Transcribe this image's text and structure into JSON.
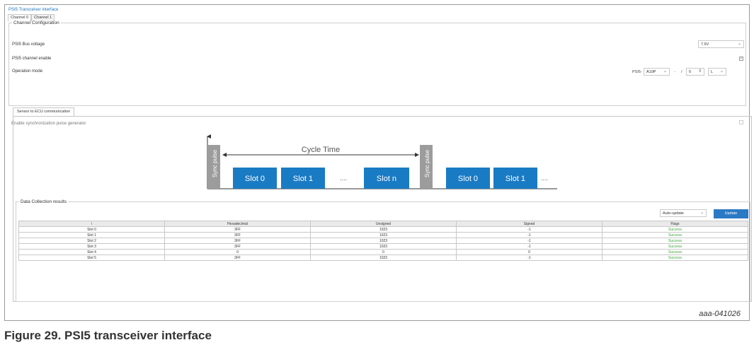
{
  "app": {
    "title": "PSI5 Transceiver interface"
  },
  "tabs": [
    "Channel 0",
    "Channel 1"
  ],
  "channel_configuration": {
    "legend": "Channel Configuration",
    "bus_voltage": {
      "label": "PSI5 Bus voltage",
      "value": "7.6V"
    },
    "channel_enable": {
      "label": "PSI5 channel enable",
      "checked": true
    },
    "operation_mode": {
      "label": "Operation mode",
      "prefix": "PSI5-",
      "mode": "A10P",
      "sep1": "-",
      "sep2": "/",
      "stepper_value": "0",
      "last": "L"
    }
  },
  "sensor_tab": {
    "label": "Sensor to ECU communication",
    "enable_sync_label": "Enable synchronization pulse generator",
    "enable_sync_checked": false
  },
  "diagram": {
    "cycle_time_label": "Cycle Time",
    "sync_pulse_label": "Sync pulse",
    "slots_first": [
      "Slot 0",
      "Slot 1",
      "Slot n"
    ],
    "dots": "....",
    "slots_second": [
      "Slot 0",
      "Slot 1"
    ],
    "dots_end": "....",
    "colors": {
      "slot": "#1a7bc5",
      "sync": "#9c9c9c"
    }
  },
  "data_collection": {
    "legend": "Data Collection results",
    "auto_update": "Auto-update",
    "update_button": "Update",
    "columns": [
      "\\",
      "Hexadecimal",
      "Unsigned",
      "Signed",
      "Flags"
    ],
    "rows": [
      [
        "Slot 0",
        "3FF",
        "1023",
        "-1",
        "Success"
      ],
      [
        "Slot 1",
        "3FF",
        "1023",
        "-1",
        "Success"
      ],
      [
        "Slot 2",
        "3FF",
        "1023",
        "-1",
        "Success"
      ],
      [
        "Slot 3",
        "3FF",
        "1023",
        "-1",
        "Success"
      ],
      [
        "Slot 4",
        "0",
        "0",
        "0",
        "Success"
      ],
      [
        "Slot 5",
        "3FF",
        "1023",
        "-1",
        "Success"
      ]
    ],
    "flag_color": "#3ba43b"
  },
  "figure": {
    "ref": "aaa-041026",
    "caption": "Figure 29.  PSI5 transceiver interface"
  }
}
